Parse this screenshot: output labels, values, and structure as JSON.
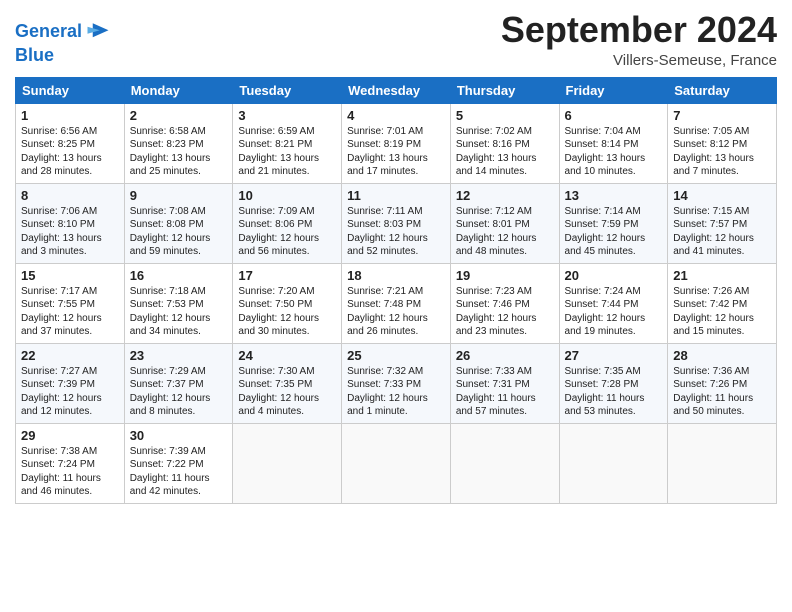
{
  "header": {
    "logo_line1": "General",
    "logo_line2": "Blue",
    "month": "September 2024",
    "location": "Villers-Semeuse, France"
  },
  "weekdays": [
    "Sunday",
    "Monday",
    "Tuesday",
    "Wednesday",
    "Thursday",
    "Friday",
    "Saturday"
  ],
  "weeks": [
    [
      {
        "day": "1",
        "info": "Sunrise: 6:56 AM\nSunset: 8:25 PM\nDaylight: 13 hours\nand 28 minutes."
      },
      {
        "day": "2",
        "info": "Sunrise: 6:58 AM\nSunset: 8:23 PM\nDaylight: 13 hours\nand 25 minutes."
      },
      {
        "day": "3",
        "info": "Sunrise: 6:59 AM\nSunset: 8:21 PM\nDaylight: 13 hours\nand 21 minutes."
      },
      {
        "day": "4",
        "info": "Sunrise: 7:01 AM\nSunset: 8:19 PM\nDaylight: 13 hours\nand 17 minutes."
      },
      {
        "day": "5",
        "info": "Sunrise: 7:02 AM\nSunset: 8:16 PM\nDaylight: 13 hours\nand 14 minutes."
      },
      {
        "day": "6",
        "info": "Sunrise: 7:04 AM\nSunset: 8:14 PM\nDaylight: 13 hours\nand 10 minutes."
      },
      {
        "day": "7",
        "info": "Sunrise: 7:05 AM\nSunset: 8:12 PM\nDaylight: 13 hours\nand 7 minutes."
      }
    ],
    [
      {
        "day": "8",
        "info": "Sunrise: 7:06 AM\nSunset: 8:10 PM\nDaylight: 13 hours\nand 3 minutes."
      },
      {
        "day": "9",
        "info": "Sunrise: 7:08 AM\nSunset: 8:08 PM\nDaylight: 12 hours\nand 59 minutes."
      },
      {
        "day": "10",
        "info": "Sunrise: 7:09 AM\nSunset: 8:06 PM\nDaylight: 12 hours\nand 56 minutes."
      },
      {
        "day": "11",
        "info": "Sunrise: 7:11 AM\nSunset: 8:03 PM\nDaylight: 12 hours\nand 52 minutes."
      },
      {
        "day": "12",
        "info": "Sunrise: 7:12 AM\nSunset: 8:01 PM\nDaylight: 12 hours\nand 48 minutes."
      },
      {
        "day": "13",
        "info": "Sunrise: 7:14 AM\nSunset: 7:59 PM\nDaylight: 12 hours\nand 45 minutes."
      },
      {
        "day": "14",
        "info": "Sunrise: 7:15 AM\nSunset: 7:57 PM\nDaylight: 12 hours\nand 41 minutes."
      }
    ],
    [
      {
        "day": "15",
        "info": "Sunrise: 7:17 AM\nSunset: 7:55 PM\nDaylight: 12 hours\nand 37 minutes."
      },
      {
        "day": "16",
        "info": "Sunrise: 7:18 AM\nSunset: 7:53 PM\nDaylight: 12 hours\nand 34 minutes."
      },
      {
        "day": "17",
        "info": "Sunrise: 7:20 AM\nSunset: 7:50 PM\nDaylight: 12 hours\nand 30 minutes."
      },
      {
        "day": "18",
        "info": "Sunrise: 7:21 AM\nSunset: 7:48 PM\nDaylight: 12 hours\nand 26 minutes."
      },
      {
        "day": "19",
        "info": "Sunrise: 7:23 AM\nSunset: 7:46 PM\nDaylight: 12 hours\nand 23 minutes."
      },
      {
        "day": "20",
        "info": "Sunrise: 7:24 AM\nSunset: 7:44 PM\nDaylight: 12 hours\nand 19 minutes."
      },
      {
        "day": "21",
        "info": "Sunrise: 7:26 AM\nSunset: 7:42 PM\nDaylight: 12 hours\nand 15 minutes."
      }
    ],
    [
      {
        "day": "22",
        "info": "Sunrise: 7:27 AM\nSunset: 7:39 PM\nDaylight: 12 hours\nand 12 minutes."
      },
      {
        "day": "23",
        "info": "Sunrise: 7:29 AM\nSunset: 7:37 PM\nDaylight: 12 hours\nand 8 minutes."
      },
      {
        "day": "24",
        "info": "Sunrise: 7:30 AM\nSunset: 7:35 PM\nDaylight: 12 hours\nand 4 minutes."
      },
      {
        "day": "25",
        "info": "Sunrise: 7:32 AM\nSunset: 7:33 PM\nDaylight: 12 hours\nand 1 minute."
      },
      {
        "day": "26",
        "info": "Sunrise: 7:33 AM\nSunset: 7:31 PM\nDaylight: 11 hours\nand 57 minutes."
      },
      {
        "day": "27",
        "info": "Sunrise: 7:35 AM\nSunset: 7:28 PM\nDaylight: 11 hours\nand 53 minutes."
      },
      {
        "day": "28",
        "info": "Sunrise: 7:36 AM\nSunset: 7:26 PM\nDaylight: 11 hours\nand 50 minutes."
      }
    ],
    [
      {
        "day": "29",
        "info": "Sunrise: 7:38 AM\nSunset: 7:24 PM\nDaylight: 11 hours\nand 46 minutes."
      },
      {
        "day": "30",
        "info": "Sunrise: 7:39 AM\nSunset: 7:22 PM\nDaylight: 11 hours\nand 42 minutes."
      },
      {
        "day": "",
        "info": ""
      },
      {
        "day": "",
        "info": ""
      },
      {
        "day": "",
        "info": ""
      },
      {
        "day": "",
        "info": ""
      },
      {
        "day": "",
        "info": ""
      }
    ]
  ]
}
